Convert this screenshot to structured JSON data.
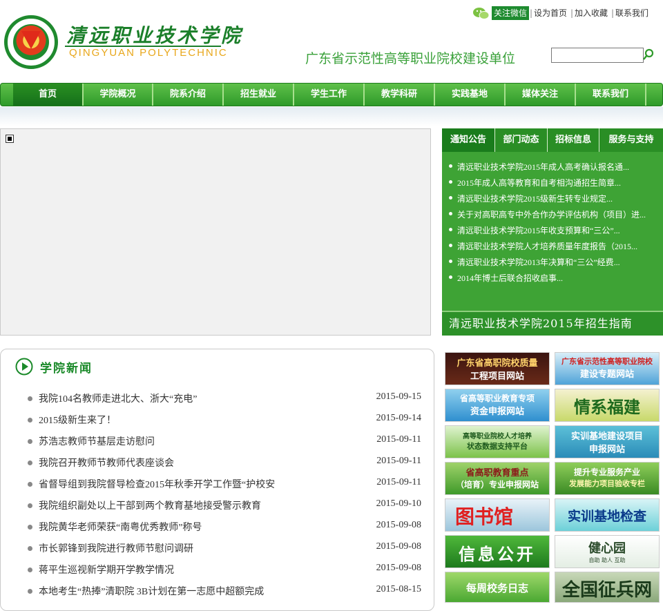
{
  "header": {
    "school_name_cn": "清远职业技术学院",
    "school_name_en": "QINGYUAN POLYTECHNIC",
    "slogan": "广东省示范性高等职业院校建设单位",
    "top_links": {
      "wechat": "关注微信",
      "set_home": "设为首页",
      "bookmark": "加入收藏",
      "contact": "联系我们",
      "separator": "|"
    },
    "search": {
      "value": ""
    }
  },
  "nav": {
    "items": [
      "首页",
      "学院概况",
      "院系介绍",
      "招生就业",
      "学生工作",
      "教学科研",
      "实践基地",
      "媒体关注",
      "联系我们"
    ]
  },
  "notice": {
    "tabs": [
      "通知公告",
      "部门动态",
      "招标信息",
      "服务与支持"
    ],
    "items": [
      "清远职业技术学院2015年成人高考确认报名通...",
      "2015年成人高等教育和自考相沟通招生简章...",
      "清远职业技术学院2015级新生转专业规定...",
      "关于对高职高专中外合作办学评估机构（项目）进...",
      "清远职业技术学院2015年收支预算和“三公”...",
      "清远职业技术学院人才培养质量年度报告（2015...",
      "清远职业技术学院2013年决算和“三公”经费...",
      "2014年博士后联合招收启事..."
    ],
    "banner": "清远职业技术学院2015年招生指南"
  },
  "news": {
    "title": "学院新闻",
    "items": [
      {
        "title": "我院104名教师走进北大、浙大“充电”",
        "date": "2015-09-15"
      },
      {
        "title": "2015级新生来了！",
        "date": "2015-09-14"
      },
      {
        "title": "苏浩志教师节基层走访慰问",
        "date": "2015-09-11"
      },
      {
        "title": "我院召开教师节教师代表座谈会",
        "date": "2015-09-11"
      },
      {
        "title": "省督导组到我院督导检查2015年秋季开学工作暨“护校安",
        "date": "2015-09-11"
      },
      {
        "title": "我院组织副处以上干部到两个教育基地接受警示教育",
        "date": "2015-09-10"
      },
      {
        "title": "我院黄华老师荣获“南粤优秀教师”称号",
        "date": "2015-09-08"
      },
      {
        "title": "市长郭锋到我院进行教师节慰问调研",
        "date": "2015-09-08"
      },
      {
        "title": "蒋平生巡视新学期开学教学情况",
        "date": "2015-09-08"
      },
      {
        "title": "本地考生“热捧”清职院 3B计划在第一志愿中超额完成",
        "date": "2015-08-15"
      }
    ]
  },
  "banners": [
    {
      "line1": "广东省高职院校质量",
      "line2": "工程项目网站"
    },
    {
      "line1": "广东省示范性高等职业院校",
      "line2": "建设专题网站"
    },
    {
      "line1": "省高等职业教育专项",
      "line2": "资金申报网站"
    },
    {
      "line1": "情系福建",
      "line2": ""
    },
    {
      "line1": "高等职业院校人才培养",
      "line2": "状态数据支持平台"
    },
    {
      "line1": "实训基地建设项目",
      "line2": "申报网站"
    },
    {
      "line1": "省高职教育重点",
      "line2": "（培育）专业申报网站"
    },
    {
      "line1": "提升专业服务产业",
      "line2": "发展能力项目验收专栏"
    },
    {
      "line1": "图书馆",
      "line2": ""
    },
    {
      "line1": "实训基地检查",
      "line2": ""
    },
    {
      "line1": "信息公开",
      "line2": ""
    },
    {
      "line1": "健心园",
      "line2": "自助  助人  互助"
    },
    {
      "line1": "每周校务日志",
      "line2": ""
    },
    {
      "line1": "全国征兵网",
      "line2": ""
    }
  ],
  "colors": {
    "brand_green": "#1e8b2f",
    "nav_green": "#3ea335",
    "logo_red": "#e02a1a",
    "logo_gold": "#e8a71b"
  }
}
